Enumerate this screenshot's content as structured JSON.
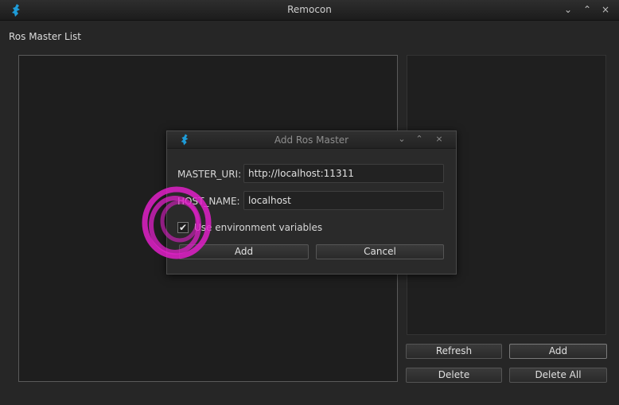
{
  "window": {
    "title": "Remocon",
    "controls": {
      "minimize": "⌄",
      "maximize": "⌃",
      "close": "×"
    }
  },
  "main": {
    "section_label": "Ros Master List",
    "buttons": {
      "refresh": "Refresh",
      "add": "Add",
      "delete": "Delete",
      "delete_all": "Delete All"
    }
  },
  "dialog": {
    "title": "Add Ros Master",
    "controls": {
      "minimize": "⌄",
      "maximize": "⌃",
      "close": "×"
    },
    "master_uri_label": "MASTER_URI:",
    "master_uri_value": "http://localhost:11311",
    "host_name_label": "HOST_NAME:",
    "host_name_value": "localhost",
    "use_env_label": "Use environment variables",
    "use_env_checked": "✔",
    "add_button": "Add",
    "cancel_button": "Cancel"
  },
  "colors": {
    "accent_icon": "#1e9bd7",
    "annotation": "#e020c8"
  },
  "icons": {
    "app": "turtle-logo-icon"
  }
}
